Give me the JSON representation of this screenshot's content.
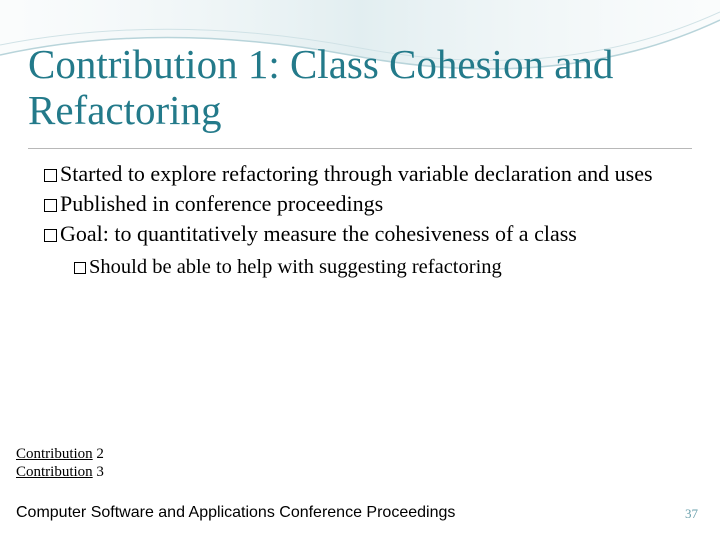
{
  "title": "Contribution 1: Class Cohesion and Refactoring",
  "bullets": [
    "Started to explore refactoring through variable declaration and uses",
    "Published in conference proceedings",
    "Goal: to quantitatively measure the cohesiveness of a class"
  ],
  "subbullet": "Should be able to help with suggesting refactoring",
  "links": {
    "a": {
      "text": "Contribution",
      "num": "2"
    },
    "b": {
      "text": "Contribution",
      "num": "3"
    }
  },
  "footer": "Computer Software and Applications Conference Proceedings",
  "page": "37"
}
